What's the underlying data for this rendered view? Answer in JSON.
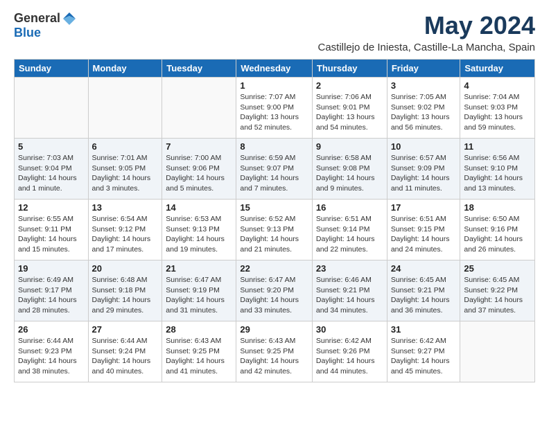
{
  "header": {
    "logo_general": "General",
    "logo_blue": "Blue",
    "month_title": "May 2024",
    "location": "Castillejo de Iniesta, Castille-La Mancha, Spain"
  },
  "days_of_week": [
    "Sunday",
    "Monday",
    "Tuesday",
    "Wednesday",
    "Thursday",
    "Friday",
    "Saturday"
  ],
  "weeks": [
    [
      {
        "day": "",
        "info": ""
      },
      {
        "day": "",
        "info": ""
      },
      {
        "day": "",
        "info": ""
      },
      {
        "day": "1",
        "info": "Sunrise: 7:07 AM\nSunset: 9:00 PM\nDaylight: 13 hours\nand 52 minutes."
      },
      {
        "day": "2",
        "info": "Sunrise: 7:06 AM\nSunset: 9:01 PM\nDaylight: 13 hours\nand 54 minutes."
      },
      {
        "day": "3",
        "info": "Sunrise: 7:05 AM\nSunset: 9:02 PM\nDaylight: 13 hours\nand 56 minutes."
      },
      {
        "day": "4",
        "info": "Sunrise: 7:04 AM\nSunset: 9:03 PM\nDaylight: 13 hours\nand 59 minutes."
      }
    ],
    [
      {
        "day": "5",
        "info": "Sunrise: 7:03 AM\nSunset: 9:04 PM\nDaylight: 14 hours\nand 1 minute."
      },
      {
        "day": "6",
        "info": "Sunrise: 7:01 AM\nSunset: 9:05 PM\nDaylight: 14 hours\nand 3 minutes."
      },
      {
        "day": "7",
        "info": "Sunrise: 7:00 AM\nSunset: 9:06 PM\nDaylight: 14 hours\nand 5 minutes."
      },
      {
        "day": "8",
        "info": "Sunrise: 6:59 AM\nSunset: 9:07 PM\nDaylight: 14 hours\nand 7 minutes."
      },
      {
        "day": "9",
        "info": "Sunrise: 6:58 AM\nSunset: 9:08 PM\nDaylight: 14 hours\nand 9 minutes."
      },
      {
        "day": "10",
        "info": "Sunrise: 6:57 AM\nSunset: 9:09 PM\nDaylight: 14 hours\nand 11 minutes."
      },
      {
        "day": "11",
        "info": "Sunrise: 6:56 AM\nSunset: 9:10 PM\nDaylight: 14 hours\nand 13 minutes."
      }
    ],
    [
      {
        "day": "12",
        "info": "Sunrise: 6:55 AM\nSunset: 9:11 PM\nDaylight: 14 hours\nand 15 minutes."
      },
      {
        "day": "13",
        "info": "Sunrise: 6:54 AM\nSunset: 9:12 PM\nDaylight: 14 hours\nand 17 minutes."
      },
      {
        "day": "14",
        "info": "Sunrise: 6:53 AM\nSunset: 9:13 PM\nDaylight: 14 hours\nand 19 minutes."
      },
      {
        "day": "15",
        "info": "Sunrise: 6:52 AM\nSunset: 9:13 PM\nDaylight: 14 hours\nand 21 minutes."
      },
      {
        "day": "16",
        "info": "Sunrise: 6:51 AM\nSunset: 9:14 PM\nDaylight: 14 hours\nand 22 minutes."
      },
      {
        "day": "17",
        "info": "Sunrise: 6:51 AM\nSunset: 9:15 PM\nDaylight: 14 hours\nand 24 minutes."
      },
      {
        "day": "18",
        "info": "Sunrise: 6:50 AM\nSunset: 9:16 PM\nDaylight: 14 hours\nand 26 minutes."
      }
    ],
    [
      {
        "day": "19",
        "info": "Sunrise: 6:49 AM\nSunset: 9:17 PM\nDaylight: 14 hours\nand 28 minutes."
      },
      {
        "day": "20",
        "info": "Sunrise: 6:48 AM\nSunset: 9:18 PM\nDaylight: 14 hours\nand 29 minutes."
      },
      {
        "day": "21",
        "info": "Sunrise: 6:47 AM\nSunset: 9:19 PM\nDaylight: 14 hours\nand 31 minutes."
      },
      {
        "day": "22",
        "info": "Sunrise: 6:47 AM\nSunset: 9:20 PM\nDaylight: 14 hours\nand 33 minutes."
      },
      {
        "day": "23",
        "info": "Sunrise: 6:46 AM\nSunset: 9:21 PM\nDaylight: 14 hours\nand 34 minutes."
      },
      {
        "day": "24",
        "info": "Sunrise: 6:45 AM\nSunset: 9:21 PM\nDaylight: 14 hours\nand 36 minutes."
      },
      {
        "day": "25",
        "info": "Sunrise: 6:45 AM\nSunset: 9:22 PM\nDaylight: 14 hours\nand 37 minutes."
      }
    ],
    [
      {
        "day": "26",
        "info": "Sunrise: 6:44 AM\nSunset: 9:23 PM\nDaylight: 14 hours\nand 38 minutes."
      },
      {
        "day": "27",
        "info": "Sunrise: 6:44 AM\nSunset: 9:24 PM\nDaylight: 14 hours\nand 40 minutes."
      },
      {
        "day": "28",
        "info": "Sunrise: 6:43 AM\nSunset: 9:25 PM\nDaylight: 14 hours\nand 41 minutes."
      },
      {
        "day": "29",
        "info": "Sunrise: 6:43 AM\nSunset: 9:25 PM\nDaylight: 14 hours\nand 42 minutes."
      },
      {
        "day": "30",
        "info": "Sunrise: 6:42 AM\nSunset: 9:26 PM\nDaylight: 14 hours\nand 44 minutes."
      },
      {
        "day": "31",
        "info": "Sunrise: 6:42 AM\nSunset: 9:27 PM\nDaylight: 14 hours\nand 45 minutes."
      },
      {
        "day": "",
        "info": ""
      }
    ]
  ]
}
